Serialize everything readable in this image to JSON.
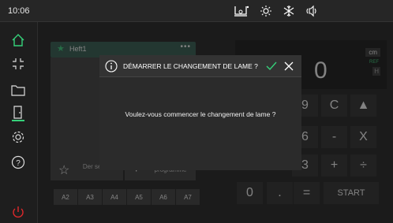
{
  "topbar": {
    "time": "10:06",
    "status_icons": [
      "machine-icon",
      "light-icon",
      "vent-icon",
      "sound-icon"
    ]
  },
  "sidebar": {
    "items": [
      {
        "icon": "home-icon",
        "active": true
      },
      {
        "icon": "expand-icon"
      },
      {
        "icon": "folder-icon"
      },
      {
        "icon": "door-icon"
      },
      {
        "icon": "settings-icon"
      },
      {
        "icon": "help-icon"
      },
      {
        "icon": "power-icon"
      }
    ]
  },
  "files": {
    "current": {
      "name": "Heft1",
      "more": "•••"
    }
  },
  "actions": {
    "favorite_label": "Der session",
    "add_label": "programme"
  },
  "programs": [
    "A2",
    "A3",
    "A4",
    "A5",
    "A6",
    "A7"
  ],
  "display": {
    "value": "0",
    "unit": "cm",
    "ref": "REF",
    "mode": "H"
  },
  "keypad": {
    "keys": [
      "9",
      "C",
      "▲",
      "6",
      "-",
      "X",
      "3",
      "+",
      "÷",
      "0",
      ".",
      "=",
      "START"
    ]
  },
  "modal": {
    "title": "DÉMARRER LE CHANGEMENT DE LAME ?",
    "message": "Voulez-vous commencer le changement de lame ?"
  },
  "colors": {
    "accent_green": "#35d17a",
    "power_red": "#e0282b",
    "background": "#1b1b1b"
  }
}
